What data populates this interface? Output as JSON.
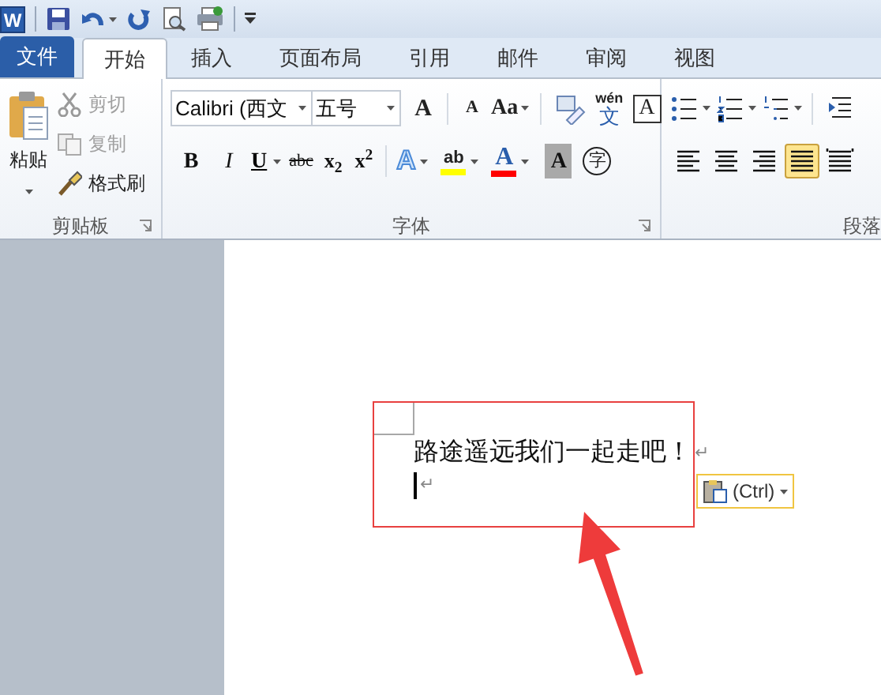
{
  "app_icon": "W",
  "tabs": [
    {
      "label": "文件",
      "kind": "file",
      "selected": false
    },
    {
      "label": "开始",
      "kind": "tab",
      "selected": true
    },
    {
      "label": "插入",
      "kind": "tab",
      "selected": false
    },
    {
      "label": "页面布局",
      "kind": "tab",
      "selected": false
    },
    {
      "label": "引用",
      "kind": "tab",
      "selected": false
    },
    {
      "label": "邮件",
      "kind": "tab",
      "selected": false
    },
    {
      "label": "审阅",
      "kind": "tab",
      "selected": false
    },
    {
      "label": "视图",
      "kind": "tab",
      "selected": false
    }
  ],
  "clipboard": {
    "paste": "粘贴",
    "items": [
      {
        "kind": "cut",
        "label": "剪切",
        "disabled": true
      },
      {
        "kind": "copy",
        "label": "复制",
        "disabled": true
      },
      {
        "kind": "painter",
        "label": "格式刷",
        "disabled": false
      }
    ],
    "group_label": "剪贴板"
  },
  "font": {
    "font_name": "Calibri (西文",
    "font_size": "五号",
    "row1": [
      {
        "kind": "grow",
        "label": "A"
      },
      {
        "kind": "shrink",
        "label": "A"
      },
      {
        "kind": "case",
        "label": "Aa"
      },
      {
        "kind": "clear"
      },
      {
        "kind": "phonetic",
        "label": "wén",
        "sub": "文"
      },
      {
        "kind": "border",
        "label": "A"
      }
    ],
    "row2": [
      {
        "kind": "bold",
        "label": "B"
      },
      {
        "kind": "italic",
        "label": "I"
      },
      {
        "kind": "underline",
        "label": "U"
      },
      {
        "kind": "strike",
        "label": "abc"
      },
      {
        "kind": "script",
        "label": "x$_{2}$"
      },
      {
        "kind": "script",
        "label": "x$^{2}$"
      },
      {
        "kind": "effects",
        "label": "A"
      },
      {
        "kind": "highlight",
        "label": "ab",
        "color": "#ffff00"
      },
      {
        "kind": "fontcolor",
        "label": "A",
        "color": "#ff0000"
      },
      {
        "kind": "shading",
        "label": "A"
      },
      {
        "kind": "enclose",
        "label": "字"
      }
    ],
    "group_label": "字体"
  },
  "paragraph": {
    "lists": [
      {
        "kind": "bullets"
      },
      {
        "kind": "numbering"
      },
      {
        "kind": "multilevel"
      },
      {
        "kind": "outdent"
      }
    ],
    "alignment": [
      {
        "kind": "left",
        "selected": false
      },
      {
        "kind": "center",
        "selected": false
      },
      {
        "kind": "right",
        "selected": false
      },
      {
        "kind": "justify",
        "selected": true
      },
      {
        "kind": "distributed",
        "selected": false
      }
    ],
    "group_label": "段落"
  },
  "document": {
    "lines": [
      {
        "text": "路途遥远我们一起走吧！",
        "mark": "↵",
        "cursor": false
      },
      {
        "mark": "↵",
        "cursor": true
      }
    ],
    "paste_options": "(Ctrl)"
  }
}
